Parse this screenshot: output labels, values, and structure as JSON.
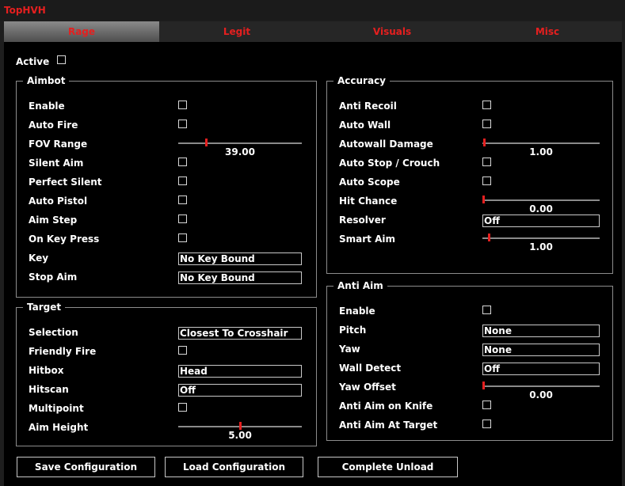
{
  "window": {
    "title": "TopHVH"
  },
  "tabs": [
    "Rage",
    "Legit",
    "Visuals",
    "Misc"
  ],
  "active_label": "Active",
  "aimbot": {
    "title": "Aimbot",
    "enable": "Enable",
    "auto_fire": "Auto Fire",
    "fov_range": "FOV Range",
    "fov_value": "39.00",
    "fov_fraction": 0.22,
    "silent_aim": "Silent Aim",
    "perfect_silent": "Perfect Silent",
    "auto_pistol": "Auto Pistol",
    "aim_step": "Aim Step",
    "on_key_press": "On Key Press",
    "key": "Key",
    "key_value": "No Key Bound",
    "stop_aim": "Stop Aim",
    "stop_aim_value": "No Key Bound"
  },
  "target": {
    "title": "Target",
    "selection": "Selection",
    "selection_value": "Closest To Crosshair",
    "friendly_fire": "Friendly Fire",
    "hitbox": "Hitbox",
    "hitbox_value": "Head",
    "hitscan": "Hitscan",
    "hitscan_value": "Off",
    "multipoint": "Multipoint",
    "aim_height": "Aim Height",
    "aim_height_value": "5.00",
    "aim_height_fraction": 0.5
  },
  "accuracy": {
    "title": "Accuracy",
    "anti_recoil": "Anti Recoil",
    "auto_wall": "Auto Wall",
    "autowall_damage": "Autowall Damage",
    "autowall_damage_value": "1.00",
    "autowall_damage_fraction": 0.01,
    "auto_stop": "Auto Stop / Crouch",
    "auto_scope": "Auto Scope",
    "hit_chance": "Hit Chance",
    "hit_chance_value": "0.00",
    "hit_chance_fraction": 0.0,
    "resolver": "Resolver",
    "resolver_value": "Off",
    "smart_aim": "Smart Aim",
    "smart_aim_value": "1.00",
    "smart_aim_fraction": 0.05
  },
  "anti_aim": {
    "title": "Anti Aim",
    "enable": "Enable",
    "pitch": "Pitch",
    "pitch_value": "None",
    "yaw": "Yaw",
    "yaw_value": "None",
    "wall_detect": "Wall Detect",
    "wall_detect_value": "Off",
    "yaw_offset": "Yaw Offset",
    "yaw_offset_value": "0.00",
    "yaw_offset_fraction": 0.0,
    "on_knife": "Anti Aim on Knife",
    "at_target": "Anti Aim At Target"
  },
  "buttons": {
    "save": "Save Configuration",
    "load": "Load Configuration",
    "unload": "Complete Unload"
  },
  "colors": {
    "accent": "#e51f1f",
    "background": "#000000",
    "border": "#8c8c8c"
  }
}
